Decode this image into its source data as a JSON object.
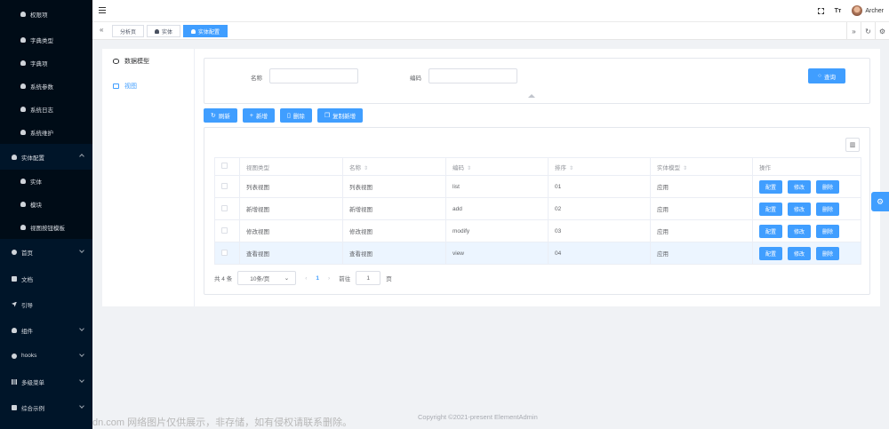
{
  "sidebar": {
    "items": [
      {
        "label": "权限项",
        "level": "sub"
      },
      {
        "label": "字典类型",
        "level": "sub"
      },
      {
        "label": "字典项",
        "level": "sub"
      },
      {
        "label": "系统参数",
        "level": "sub"
      },
      {
        "label": "系统日志",
        "level": "sub"
      },
      {
        "label": "系统维护",
        "level": "sub"
      },
      {
        "label": "实体配置",
        "level": "top",
        "expanded": true
      },
      {
        "label": "实体",
        "level": "sub"
      },
      {
        "label": "模块",
        "level": "sub"
      },
      {
        "label": "视图按钮模板",
        "level": "sub"
      },
      {
        "label": "首页",
        "level": "top"
      },
      {
        "label": "文档",
        "level": "top"
      },
      {
        "label": "引导",
        "level": "top"
      },
      {
        "label": "组件",
        "level": "top"
      },
      {
        "label": "hooks",
        "level": "top"
      },
      {
        "label": "多级菜单",
        "level": "top"
      },
      {
        "label": "综合示例",
        "level": "top"
      }
    ]
  },
  "header": {
    "user_name": "Archer",
    "font_icon_text": "Tт"
  },
  "tabs": [
    {
      "label": "分析页",
      "active": false
    },
    {
      "label": "实体",
      "active": false
    },
    {
      "label": "实体配置",
      "active": true
    }
  ],
  "tree": {
    "items": [
      {
        "label": "数据模型",
        "active": false
      },
      {
        "label": "视图",
        "active": true
      }
    ]
  },
  "search": {
    "name_label": "名称",
    "code_label": "编码",
    "name_value": "",
    "code_value": "",
    "query_button": "查询"
  },
  "toolbar": {
    "refresh": "刷新",
    "add": "新增",
    "delete": "删除",
    "copy_add": "复制新增"
  },
  "table": {
    "headers": [
      "视图类型",
      "名称",
      "编码",
      "排序",
      "实体模型",
      "操作"
    ],
    "rows": [
      {
        "type": "列表视图",
        "name": "列表视图",
        "code": "list",
        "order": "01",
        "model": "应用"
      },
      {
        "type": "新增视图",
        "name": "新增视图",
        "code": "add",
        "order": "02",
        "model": "应用"
      },
      {
        "type": "修改视图",
        "name": "修改视图",
        "code": "modify",
        "order": "03",
        "model": "应用"
      },
      {
        "type": "查看视图",
        "name": "查看视图",
        "code": "view",
        "order": "04",
        "model": "应用"
      }
    ],
    "op_config": "配置",
    "op_edit": "修改",
    "op_delete": "删除"
  },
  "pagination": {
    "total": "共 4 条",
    "page_size": "10条/页",
    "current_page": "1",
    "goto_label": "前往",
    "goto_value": "1",
    "page_suffix": "页"
  },
  "footer": {
    "copyright": "Copyright ©2021-present ElementAdmin"
  },
  "watermark": {
    "text": "dn.com 网络图片仅供展示，非存储，如有侵权请联系删除。"
  },
  "colors": {
    "primary": "#409eff",
    "sidebar_bg": "#001529"
  }
}
